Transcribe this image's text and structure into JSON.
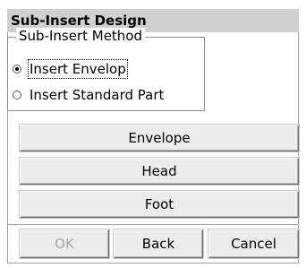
{
  "dialog": {
    "title": "Sub-Insert Design"
  },
  "method_group": {
    "label": "Sub-Insert Method",
    "options": [
      {
        "label": "Insert Envelop",
        "checked": true
      },
      {
        "label": "Insert Standard Part",
        "checked": false
      }
    ]
  },
  "actions": {
    "envelope": "Envelope",
    "head": "Head",
    "foot": "Foot"
  },
  "footer": {
    "ok": "OK",
    "back": "Back",
    "cancel": "Cancel"
  }
}
